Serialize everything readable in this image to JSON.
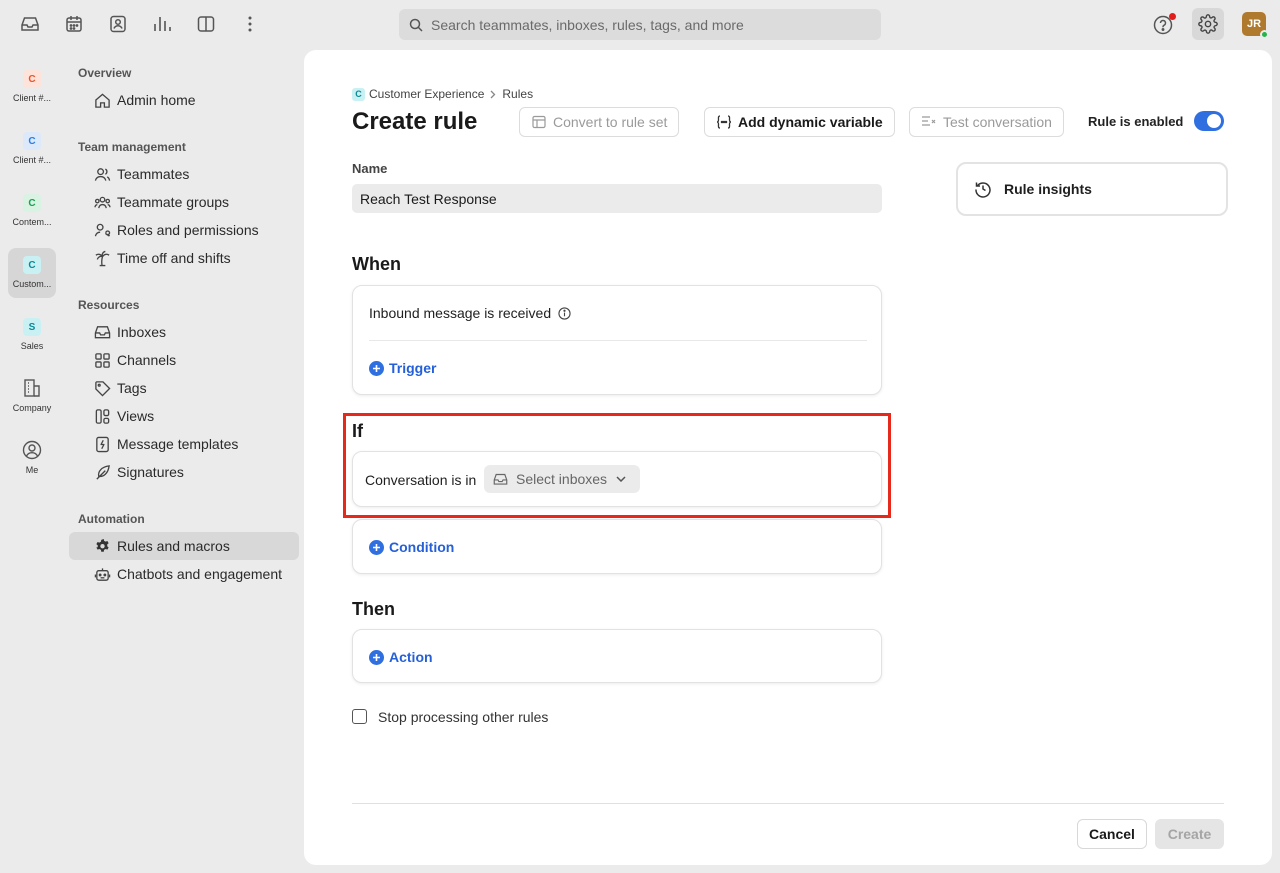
{
  "topbar": {
    "icons": [
      "inbox-icon",
      "calendar-icon",
      "contacts-icon",
      "analytics-icon",
      "layout-icon",
      "more-icon"
    ],
    "search_placeholder": "Search teammates, inboxes, rules, tags, and more",
    "avatar_initials": "JR"
  },
  "workspaces": [
    {
      "badge": "C",
      "label": "Client #...",
      "color": "#e8552d",
      "bg": "#fde3d9"
    },
    {
      "badge": "C",
      "label": "Client #...",
      "color": "#2a7de1",
      "bg": "#dbe9fb"
    },
    {
      "badge": "C",
      "label": "Contem...",
      "color": "#1f9d55",
      "bg": "#d8f3e1"
    },
    {
      "badge": "C",
      "label": "Custom...",
      "color": "#0b8a94",
      "bg": "#c9f1f4"
    },
    {
      "badge": "S",
      "label": "Sales",
      "color": "#0b8a94",
      "bg": "#c9f1f4"
    },
    {
      "label": "Company",
      "icon": "building-icon"
    },
    {
      "label": "Me",
      "icon": "user-circle-icon"
    }
  ],
  "nav": {
    "overview": "Overview",
    "admin_home": "Admin home",
    "team_management": "Team management",
    "teammates": "Teammates",
    "teammate_groups": "Teammate groups",
    "roles_permissions": "Roles and permissions",
    "time_off": "Time off and shifts",
    "resources": "Resources",
    "inboxes": "Inboxes",
    "channels": "Channels",
    "tags": "Tags",
    "views": "Views",
    "message_templates": "Message templates",
    "signatures": "Signatures",
    "automation": "Automation",
    "rules_macros": "Rules and macros",
    "chatbots": "Chatbots and engagement"
  },
  "main": {
    "breadcrumb_badge": "C",
    "breadcrumb_workspace": "Customer Experience",
    "breadcrumb_page": "Rules",
    "title": "Create rule",
    "convert_button": "Convert to rule set",
    "dynamic_variable_button": "Add dynamic variable",
    "test_button": "Test conversation",
    "enabled_label": "Rule is enabled",
    "enabled": true,
    "name_label": "Name",
    "name_value": "Reach Test Response",
    "insights": "Rule insights",
    "when_title": "When",
    "trigger_text": "Inbound message is received",
    "trigger_link": "Trigger",
    "if_title": "If",
    "condition_text": "Conversation is in",
    "select_inboxes": "Select inboxes",
    "condition_link": "Condition",
    "then_title": "Then",
    "action_link": "Action",
    "stop_processing": "Stop processing other rules",
    "cancel": "Cancel",
    "create": "Create"
  },
  "colors": {
    "accent": "#2f6fe0",
    "highlight": "#e8281b"
  }
}
